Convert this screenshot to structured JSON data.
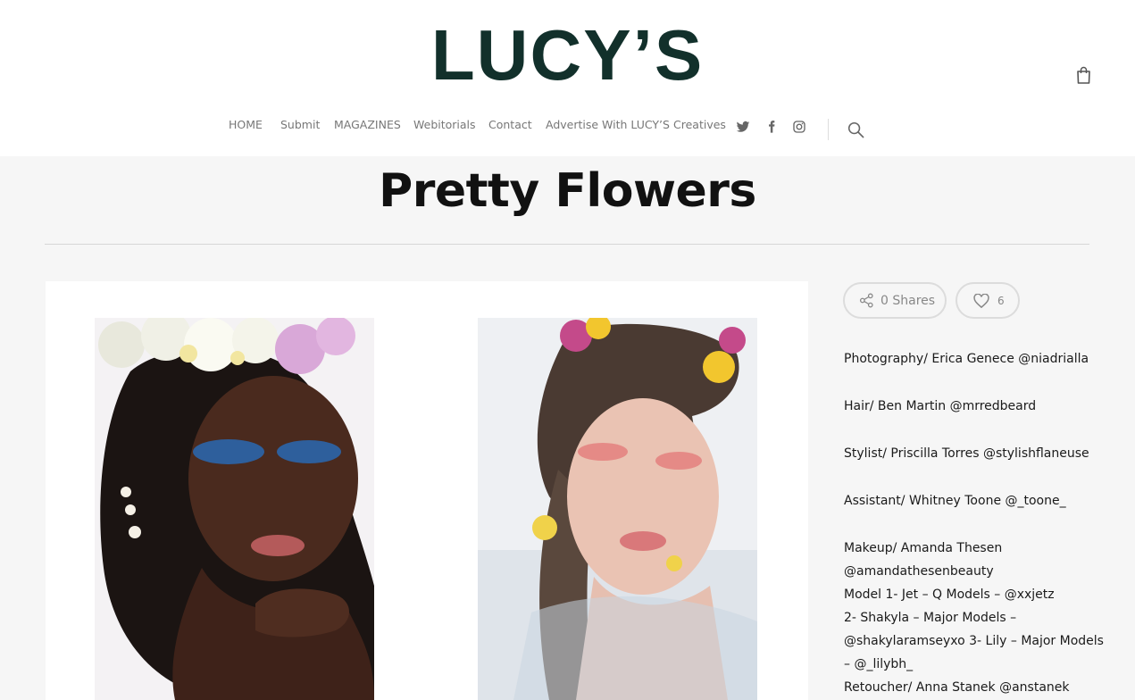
{
  "site": {
    "logo_text": "LUCY’S"
  },
  "nav": {
    "items": [
      {
        "label": "HOME"
      },
      {
        "label": "Submit"
      },
      {
        "label": "MAGAZINES"
      },
      {
        "label": "Webitorials"
      },
      {
        "label": "Contact"
      },
      {
        "label": "Advertise With LUCY’S"
      },
      {
        "label": "Creatives"
      }
    ],
    "social_icons": [
      "twitter-icon",
      "facebook-icon",
      "instagram-icon"
    ],
    "search_icon": "search-icon",
    "cart_icon": "shopping-bag-icon"
  },
  "post": {
    "title": "Pretty Flowers"
  },
  "actions": {
    "shares_label": "0 Shares",
    "likes_count": "6"
  },
  "credits": [
    "Photography/ Erica Genece @niadrialla",
    "Hair/ Ben Martin @mrredbeard",
    "Stylist/ Priscilla Torres @stylishflaneuse",
    "Assistant/ Whitney Toone @_toone_",
    "Makeup/ Amanda Thesen",
    "@amandathesenbeauty",
    "Model 1- Jet – Q Models – @xxjetz",
    "2- Shakyla – Major Models –",
    "@shakylaramseyxo 3- Lily – Major Models",
    "– @_lilybh_",
    "Retoucher/ Anna Stanek @anstanek"
  ],
  "colors": {
    "logo": "#12302b",
    "nav_text": "#777777",
    "page_bg": "#f6f6f6"
  }
}
